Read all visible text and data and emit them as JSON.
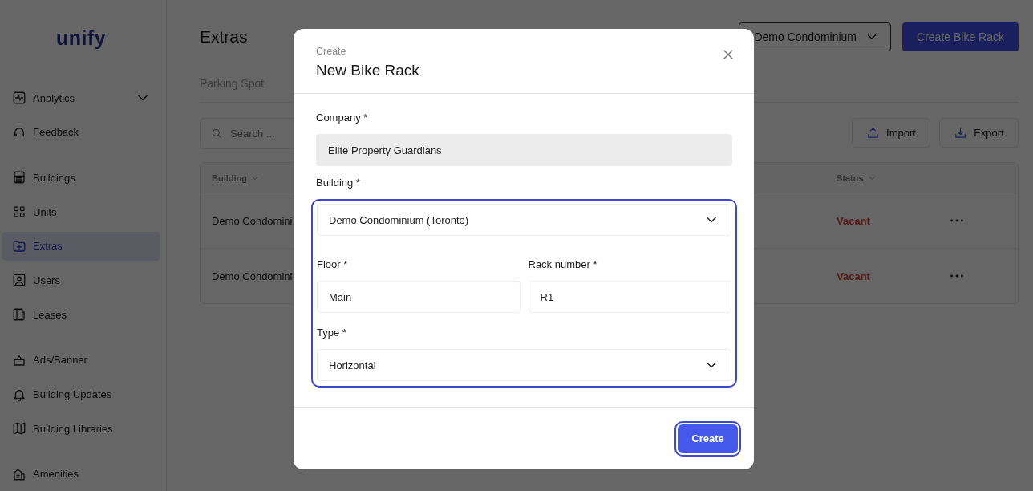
{
  "sidebar": {
    "logo": "unify",
    "groups": [
      [
        {
          "label": "Analytics",
          "selected": false,
          "expanded": false
        },
        {
          "label": "Feedback",
          "selected": false
        }
      ],
      [
        {
          "label": "Buildings",
          "selected": false
        },
        {
          "label": "Units",
          "selected": false
        },
        {
          "label": "Extras",
          "selected": true
        },
        {
          "label": "Users",
          "selected": false
        },
        {
          "label": "Leases",
          "selected": false
        }
      ],
      [
        {
          "label": "Ads/Banner",
          "selected": false
        },
        {
          "label": "Building Updates",
          "selected": false
        },
        {
          "label": "Building Libraries",
          "selected": false
        }
      ],
      [
        {
          "label": "Amenities",
          "selected": false
        }
      ]
    ]
  },
  "header": {
    "title": "Extras",
    "building_select": "Demo Condominium",
    "primary_button": "Create Bike Rack"
  },
  "tabs": [
    {
      "label": "Parking Spot",
      "selected": false
    }
  ],
  "search": {
    "placeholder": "Search ..."
  },
  "actions": [
    "Import",
    "Export"
  ],
  "table": {
    "columns": [
      "Building",
      "Status"
    ],
    "rows": [
      {
        "building": "Demo Condomini",
        "status": "Vacant"
      },
      {
        "building": "Demo Condomini",
        "status": "Vacant"
      }
    ]
  },
  "modal": {
    "subtitle": "Create",
    "title": "New Bike Rack",
    "sections": [
      {
        "highlighted": false,
        "rows": [
          [
            {
              "kind": "text",
              "label": "Company *",
              "value": "Elite Property Guardians",
              "disabled": true
            }
          ]
        ]
      },
      {
        "highlighted": true,
        "rows": [
          [
            {
              "kind": "select",
              "label": "Building *",
              "value": "Demo Condominium (Toronto)",
              "disabled": false
            }
          ],
          [
            {
              "kind": "text",
              "label": "Floor *",
              "value": "Main",
              "disabled": false
            },
            {
              "kind": "text",
              "label": "Rack number *",
              "value": "R1",
              "disabled": false
            }
          ],
          [
            {
              "kind": "select",
              "label": "Type *",
              "value": "Horizontal",
              "disabled": false
            }
          ]
        ]
      }
    ],
    "submit": {
      "label": "Create",
      "focused": true
    }
  }
}
